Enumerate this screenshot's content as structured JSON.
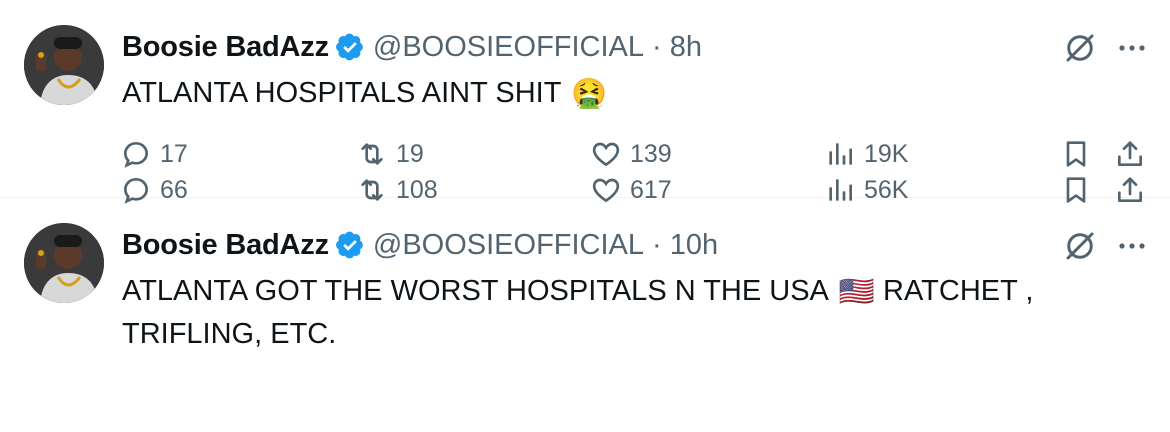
{
  "tweets": [
    {
      "author_name": "Boosie BadAzz",
      "handle": "@BOOSIEOFFICIAL",
      "time": "8h",
      "text": "ATLANTA HOSPITALS  AINT SHIT",
      "emoji": "🤮",
      "replies": "17",
      "retweets": "19",
      "likes": "139",
      "views": "19K"
    },
    {
      "author_name": "Boosie BadAzz",
      "handle": "@BOOSIEOFFICIAL",
      "time": "10h",
      "text_line1": "ATLANTA GOT THE  WORST HOSPITALS N THE USA",
      "emoji": "🇺🇸",
      "text_line1_after": "RATCHET ,",
      "text_line2": "TRIFLING, ETC.",
      "replies": "66",
      "retweets": "108",
      "likes": "617",
      "views": "56K"
    }
  ],
  "colors": {
    "verified": "#1d9bf0",
    "muted": "#536471",
    "text": "#0f1419"
  },
  "icons": [
    "verified-badge-icon",
    "grok-icon",
    "more-icon",
    "reply-icon",
    "retweet-icon",
    "like-icon",
    "views-icon",
    "bookmark-icon",
    "share-icon"
  ]
}
